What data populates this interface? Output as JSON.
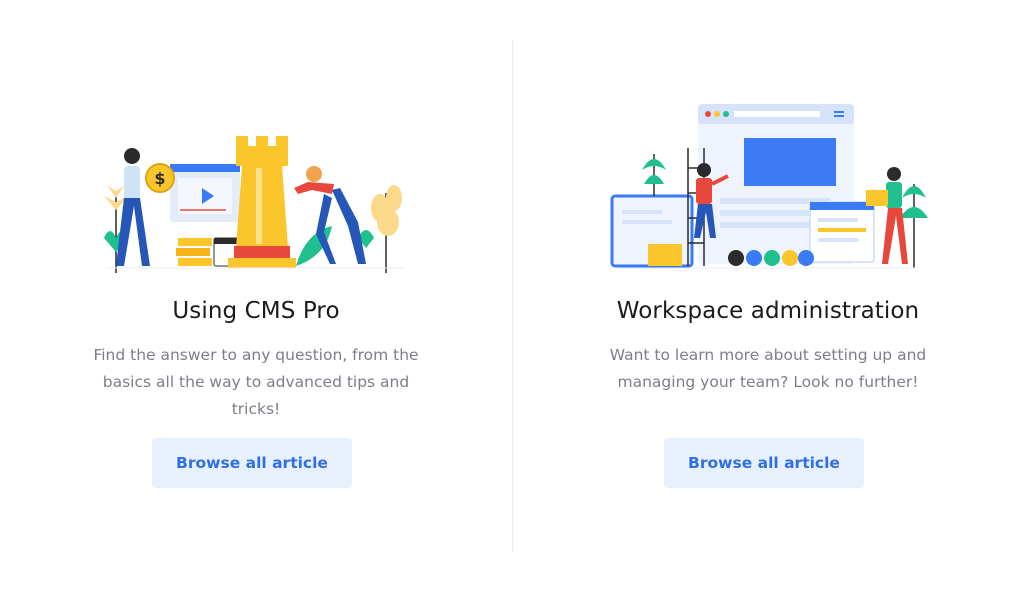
{
  "cards": [
    {
      "title": "Using CMS Pro",
      "description": "Find the answer to any question, from the basics all the way to advanced tips and tricks!",
      "button_label": "Browse all article",
      "illustration": "chess-rook-business-illustration"
    },
    {
      "title": "Workspace administration",
      "description": "Want to learn more about setting up and managing your team? Look no further!",
      "button_label": "Browse all article",
      "illustration": "team-website-building-illustration"
    }
  ],
  "colors": {
    "accent": "#2f6fe6",
    "button_bg": "#e9f0fd",
    "title": "#1b1b1f",
    "text": "#7c7f88",
    "yellow": "#fbc52c",
    "green": "#1fbf8f",
    "red": "#e8483b"
  }
}
